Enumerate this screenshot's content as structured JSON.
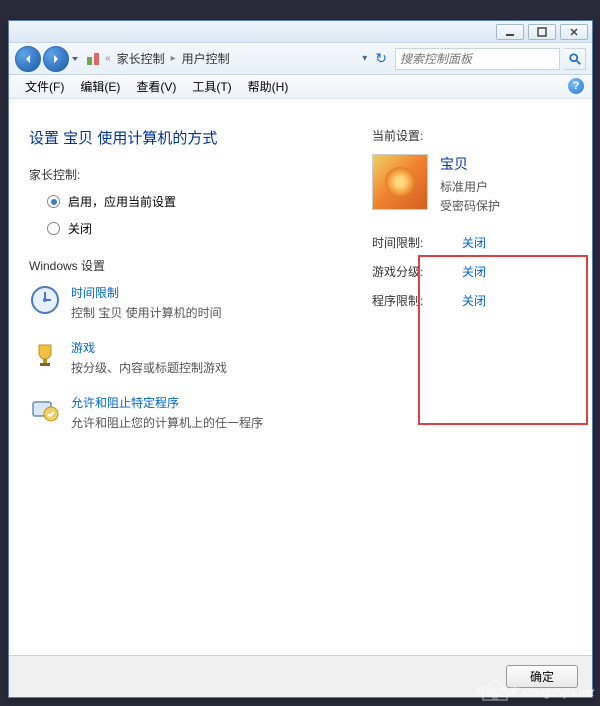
{
  "titlebar": {
    "min": "—",
    "max": "▢",
    "close": "✕"
  },
  "breadcrumb": {
    "item1": "家长控制",
    "item2": "用户控制"
  },
  "search": {
    "placeholder": "搜索控制面板"
  },
  "menu": {
    "file": "文件(F)",
    "edit": "编辑(E)",
    "view": "查看(V)",
    "tools": "工具(T)",
    "help": "帮助(H)"
  },
  "help_icon": "?",
  "heading": "设置 宝贝 使用计算机的方式",
  "parental_label": "家长控制:",
  "radio": {
    "on": "启用，应用当前设置",
    "off": "关闭"
  },
  "win_settings_label": "Windows 设置",
  "settings": {
    "time": {
      "title": "时间限制",
      "desc": "控制 宝贝 使用计算机的时间"
    },
    "games": {
      "title": "游戏",
      "desc": "按分级、内容或标题控制游戏"
    },
    "programs": {
      "title": "允许和阻止特定程序",
      "desc": "允许和阻止您的计算机上的任一程序"
    }
  },
  "right": {
    "current_label": "当前设置:",
    "user": {
      "name": "宝贝",
      "type": "标准用户",
      "password": "受密码保护"
    },
    "rows": {
      "time": {
        "label": "时间限制:",
        "value": "关闭"
      },
      "games": {
        "label": "游戏分级:",
        "value": "关闭"
      },
      "programs": {
        "label": "程序限制:",
        "value": "关闭"
      }
    }
  },
  "footer": {
    "ok": "确定"
  },
  "watermark": "系统之家 xitongzhijia.net"
}
